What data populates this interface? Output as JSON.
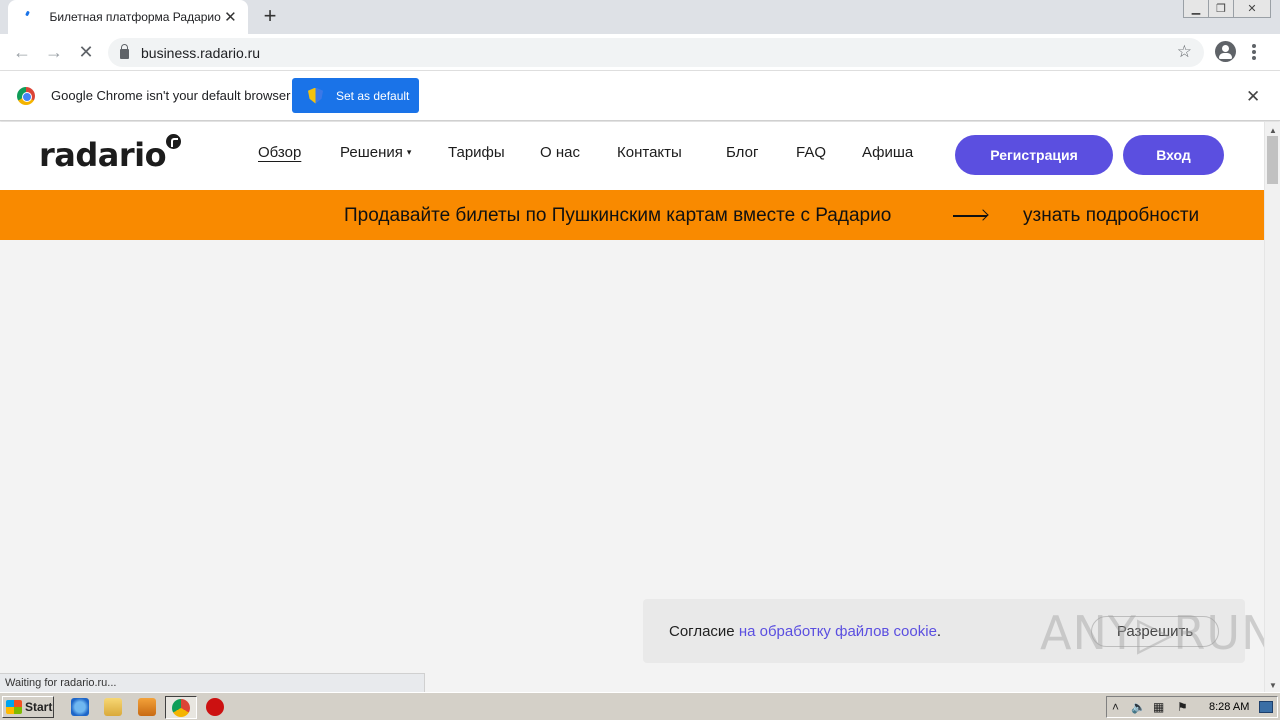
{
  "browser": {
    "tab_title": "Билетная платформа Радарио",
    "tab_close": "✕",
    "new_tab": "+",
    "url": "business.radario.ru",
    "infobar_text": "Google Chrome isn't your default browser",
    "infobar_button": "Set as default",
    "infobar_close": "✕",
    "status_text": "Waiting for radario.ru..."
  },
  "site": {
    "logo": "radario",
    "nav": [
      {
        "label": "Обзор",
        "active": true
      },
      {
        "label": "Решения",
        "caret": "▾"
      },
      {
        "label": "Тарифы"
      },
      {
        "label": "О нас"
      },
      {
        "label": "Контакты"
      },
      {
        "label": "Блог"
      },
      {
        "label": "FAQ"
      },
      {
        "label": "Афиша"
      }
    ],
    "register_label": "Регистрация",
    "login_label": "Вход",
    "promo_text": "Продавайте билеты по Пушкинским картам вместе с Радарио",
    "promo_link": "узнать подробности",
    "cookie_text_before": "Согласие ",
    "cookie_link": "на обработку файлов cookie",
    "cookie_text_after": ".",
    "cookie_button": "Разрешить"
  },
  "watermark": "ANY▷RUN",
  "taskbar": {
    "start_label": "Start",
    "clock": "8:28 AM"
  },
  "colors": {
    "accent": "#5b4fe0",
    "promo": "#f98a00",
    "chrome_blue": "#1a73e8"
  }
}
